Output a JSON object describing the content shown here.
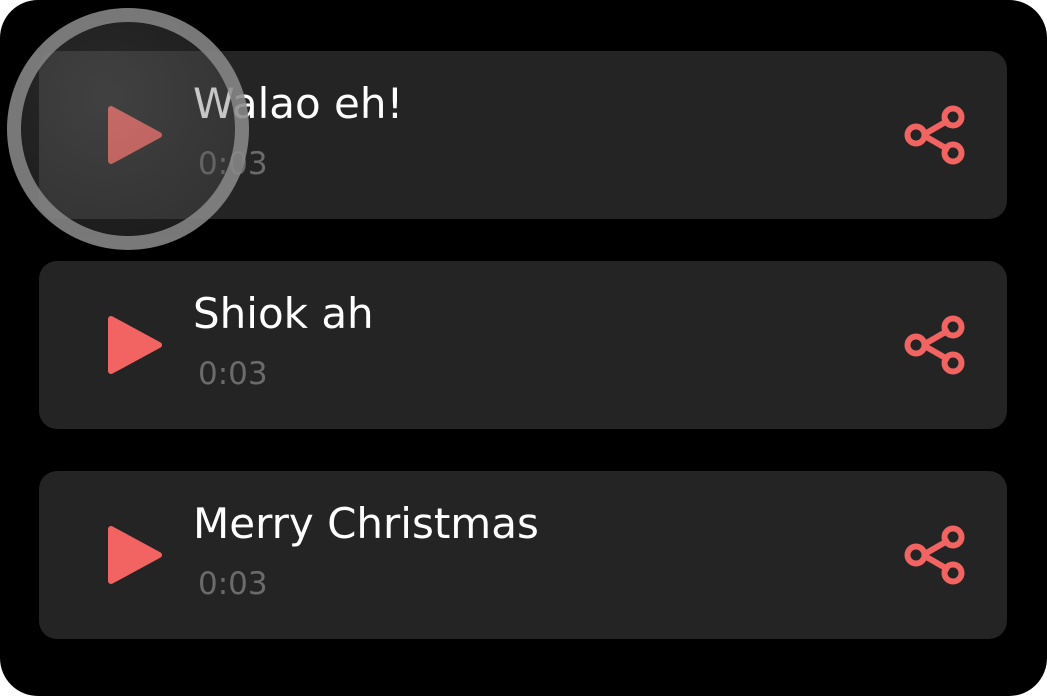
{
  "sounds": [
    {
      "title": "Walao eh!",
      "duration": "0:03"
    },
    {
      "title": "Shiok ah",
      "duration": "0:03"
    },
    {
      "title": "Merry Christmas",
      "duration": "0:03"
    }
  ],
  "icons": {
    "play": "play-icon",
    "share": "share-icon"
  },
  "colors": {
    "background": "#000000",
    "card": "#242424",
    "accent": "#f26462",
    "title": "#ffffff",
    "duration": "#6b6b6b"
  }
}
